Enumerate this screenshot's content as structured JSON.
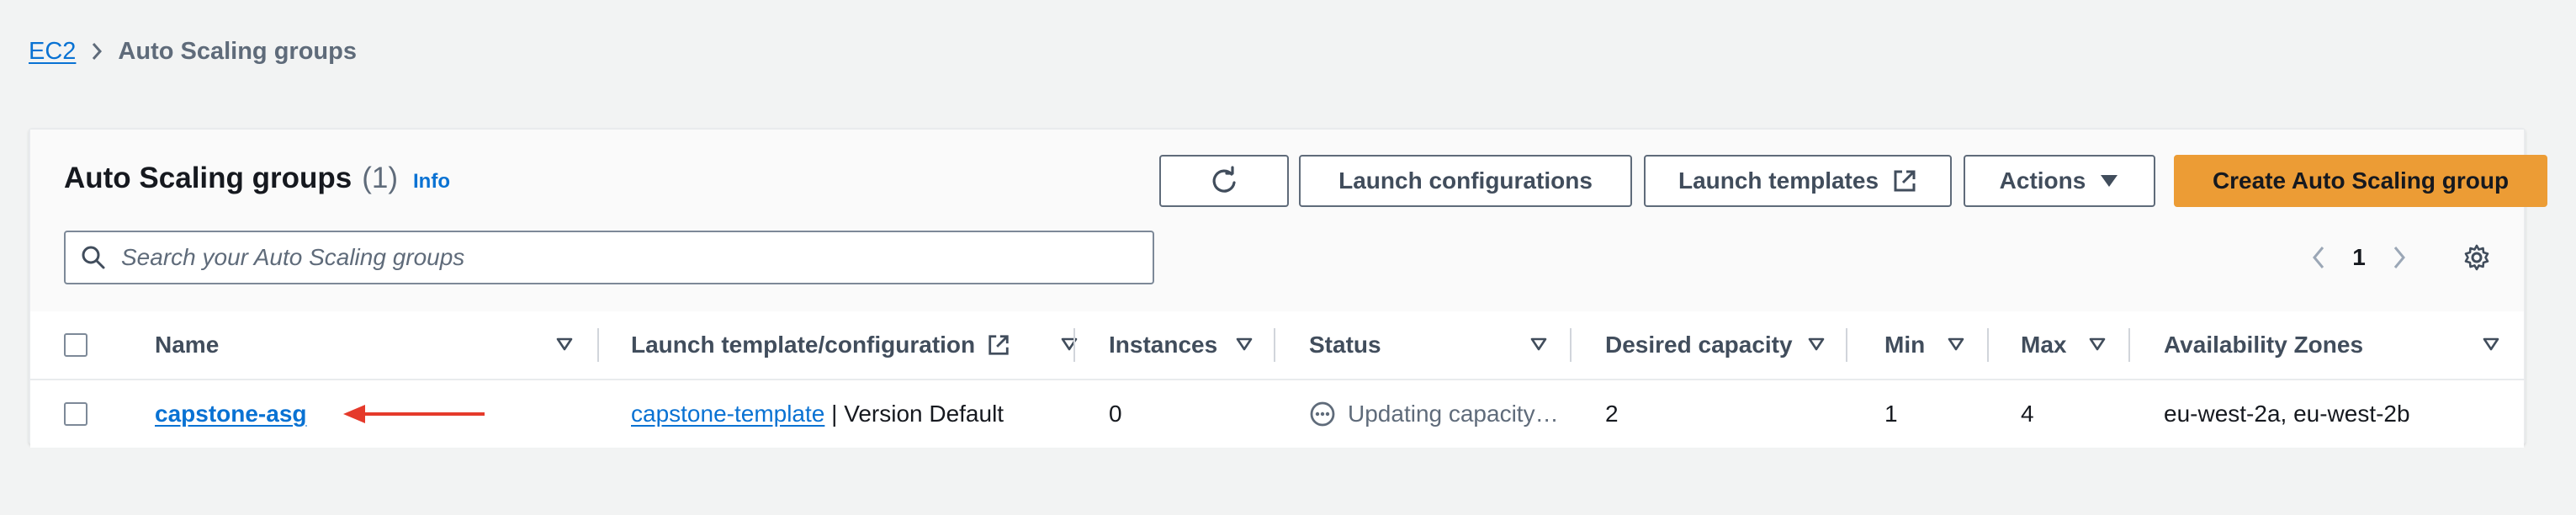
{
  "breadcrumb": {
    "root": "EC2",
    "current": "Auto Scaling groups"
  },
  "header": {
    "title": "Auto Scaling groups",
    "count": "(1)",
    "info": "Info",
    "buttons": {
      "launch_configurations": "Launch configurations",
      "launch_templates": "Launch templates",
      "actions": "Actions",
      "create": "Create Auto Scaling group"
    },
    "search_placeholder": "Search your Auto Scaling groups"
  },
  "pagination": {
    "current_page": "1"
  },
  "table": {
    "columns": [
      "Name",
      "Launch template/configuration",
      "Instances",
      "Status",
      "Desired capacity",
      "Min",
      "Max",
      "Availability Zones"
    ],
    "rows": [
      {
        "name": "capstone-asg",
        "launch_template": "capstone-template",
        "launch_template_suffix": " | Version Default",
        "instances": "0",
        "status": "Updating capacity…",
        "desired_capacity": "2",
        "min": "1",
        "max": "4",
        "availability_zones": "eu-west-2a, eu-west-2b"
      }
    ]
  },
  "icons": {
    "refresh": "refresh-icon",
    "external_link": "external-link-icon",
    "caret_down": "caret-down-icon",
    "search": "search-icon",
    "settings": "gear-icon",
    "status": "in-progress-icon",
    "annotation": "arrow-left-annotation"
  },
  "colors": {
    "link": "#0972d3",
    "primary_button": "#ec9c35",
    "annotation_arrow": "#e53a2b",
    "background": "#f2f3f3"
  }
}
